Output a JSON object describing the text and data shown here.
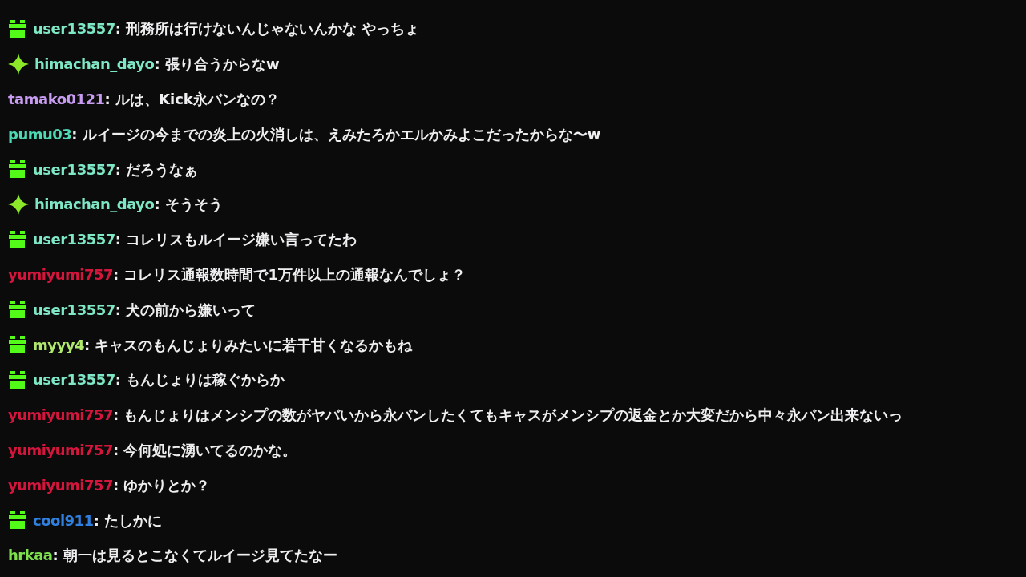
{
  "messages": [
    {
      "kind": "gift",
      "user": "user13557",
      "color": "#7ee8c6",
      "text": ": 刑務所は行けないんじゃないんかな やっちょ"
    },
    {
      "kind": "sparkle",
      "user": "himachan_dayo",
      "color": "#7ee8c6",
      "text": ": 張り合うからなw"
    },
    {
      "kind": "plain",
      "user": "tamako0121",
      "color": "#c89cf0",
      "text": ": ルは、Kick永バンなの？"
    },
    {
      "kind": "plain",
      "user": "pumu03",
      "color": "#4fd8b4",
      "text": ": ルイージの今までの炎上の火消しは、えみたろかエルかみよこだったからな〜w"
    },
    {
      "kind": "gift",
      "user": "user13557",
      "color": "#7ee8c6",
      "text": ": だろうなぁ"
    },
    {
      "kind": "sparkle",
      "user": "himachan_dayo",
      "color": "#7ee8c6",
      "text": ": そうそう"
    },
    {
      "kind": "gift",
      "user": "user13557",
      "color": "#7ee8c6",
      "text": ": コレリスもルイージ嫌い言ってたわ"
    },
    {
      "kind": "plain",
      "user": "yumiyumi757",
      "color": "#d4163c",
      "text": ": コレリス通報数時間で1万件以上の通報なんでしょ？"
    },
    {
      "kind": "gift",
      "user": "user13557",
      "color": "#7ee8c6",
      "text": ": 犬の前から嫌いって"
    },
    {
      "kind": "gift",
      "user": "myyy4",
      "color": "#aee86c",
      "text": ": キャスのもんじょりみたいに若干甘くなるかもね"
    },
    {
      "kind": "gift",
      "user": "user13557",
      "color": "#7ee8c6",
      "text": ": もんじょりは稼ぐからか"
    },
    {
      "kind": "plain",
      "user": "yumiyumi757",
      "color": "#d4163c",
      "text": ": もんじょりはメンシプの数がヤバいから永バンしたくてもキャスがメンシプの返金とか大変だから中々永バン出来ないっ"
    },
    {
      "kind": "plain",
      "user": "yumiyumi757",
      "color": "#d4163c",
      "text": ": 今何処に湧いてるのかな。"
    },
    {
      "kind": "plain",
      "user": "yumiyumi757",
      "color": "#d4163c",
      "text": ": ゆかりとか？"
    },
    {
      "kind": "gift",
      "user": "cool911",
      "color": "#3080e0",
      "text": ": たしかに"
    },
    {
      "kind": "plain",
      "user": "hrkaa",
      "color": "#7ee04c",
      "text": ": 朝一は見るとこなくてルイージ見てたなー"
    }
  ]
}
